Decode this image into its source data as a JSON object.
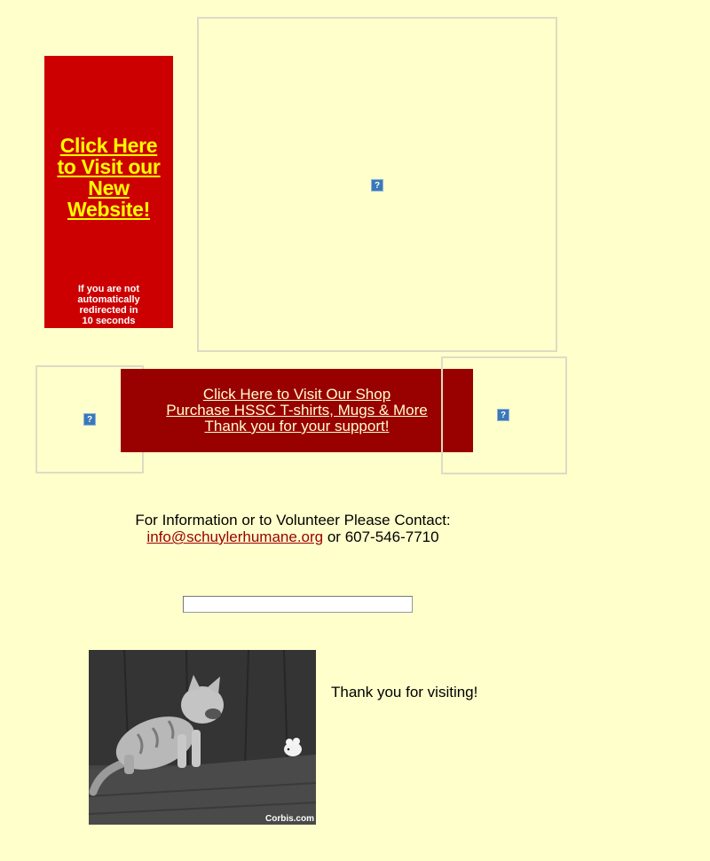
{
  "promo": {
    "link_lines": [
      "Click Here",
      "to Visit our",
      "New",
      "Website!"
    ],
    "note_lines": [
      "If you are not",
      "automatically",
      "redirected in",
      "10 seconds"
    ]
  },
  "broken_image": {
    "glyph": "?"
  },
  "shop": {
    "lines": [
      "Click Here to Visit Our Shop",
      "Purchase HSSC T-shirts, Mugs & More",
      "Thank you for your support!"
    ]
  },
  "contact": {
    "heading": "For Information or to Volunteer Please Contact:",
    "email": "info@schuylerhumane.org",
    "separator": " or ",
    "phone": "607-546-7710"
  },
  "search": {
    "value": "",
    "placeholder": ""
  },
  "photo": {
    "credit": "Corbis.com"
  },
  "footer": {
    "thanks": "Thank you for visiting!"
  },
  "colors": {
    "background": "#ffffcc",
    "promo_red": "#cc0000",
    "promo_link": "#ffff00",
    "banner_red": "#990000",
    "email_link": "#990000"
  }
}
